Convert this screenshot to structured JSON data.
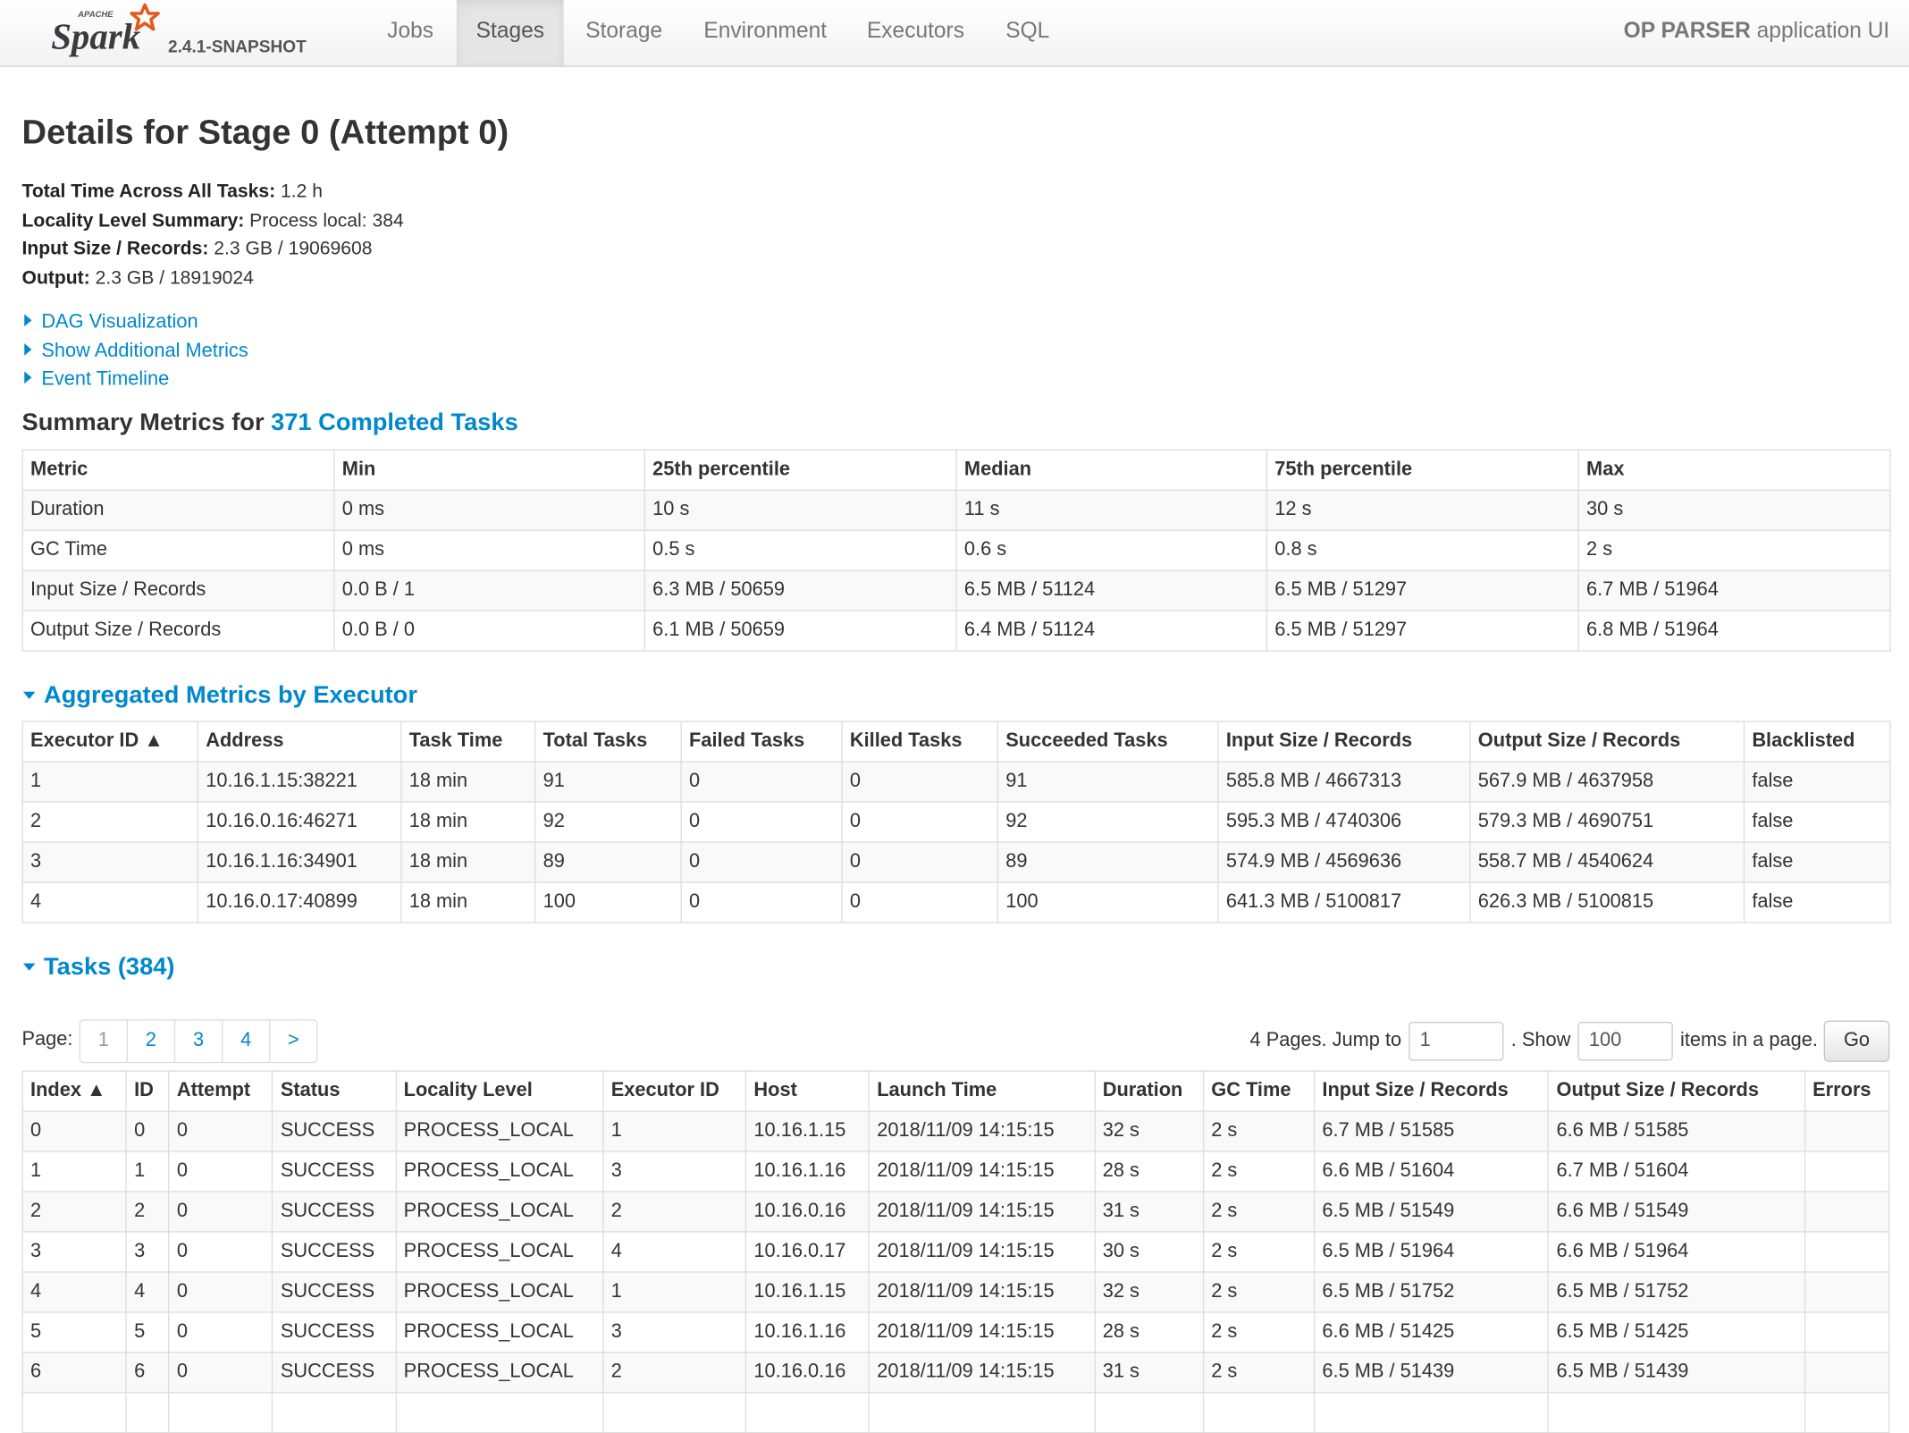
{
  "navbar": {
    "brand_small": "APACHE",
    "brand": "Spark",
    "version": "2.4.1-SNAPSHOT",
    "tabs": [
      "Jobs",
      "Stages",
      "Storage",
      "Environment",
      "Executors",
      "SQL"
    ],
    "active_tab": "Stages",
    "app_name_bold": "OP PARSER",
    "app_name_rest": " application UI"
  },
  "page": {
    "title": "Details for Stage 0 (Attempt 0)",
    "summary": [
      {
        "label": "Total Time Across All Tasks:",
        "value": " 1.2 h"
      },
      {
        "label": "Locality Level Summary:",
        "value": " Process local: 384"
      },
      {
        "label": "Input Size / Records:",
        "value": " 2.3 GB / 19069608"
      },
      {
        "label": "Output:",
        "value": " 2.3 GB / 18919024"
      }
    ],
    "expanders": [
      "DAG Visualization",
      "Show Additional Metrics",
      "Event Timeline"
    ]
  },
  "summary_metrics": {
    "heading_prefix": "Summary Metrics for ",
    "heading_link": "371 Completed Tasks",
    "columns": [
      "Metric",
      "Min",
      "25th percentile",
      "Median",
      "75th percentile",
      "Max"
    ],
    "rows": [
      [
        "Duration",
        "0 ms",
        "10 s",
        "11 s",
        "12 s",
        "30 s"
      ],
      [
        "GC Time",
        "0 ms",
        "0.5 s",
        "0.6 s",
        "0.8 s",
        "2 s"
      ],
      [
        "Input Size / Records",
        "0.0 B / 1",
        "6.3 MB / 50659",
        "6.5 MB / 51124",
        "6.5 MB / 51297",
        "6.7 MB / 51964"
      ],
      [
        "Output Size / Records",
        "0.0 B / 0",
        "6.1 MB / 50659",
        "6.4 MB / 51124",
        "6.5 MB / 51297",
        "6.8 MB / 51964"
      ]
    ]
  },
  "executor_metrics": {
    "heading": "Aggregated Metrics by Executor",
    "columns": [
      "Executor ID ▲",
      "Address",
      "Task Time",
      "Total Tasks",
      "Failed Tasks",
      "Killed Tasks",
      "Succeeded Tasks",
      "Input Size / Records",
      "Output Size / Records",
      "Blacklisted"
    ],
    "rows": [
      [
        "1",
        "10.16.1.15:38221",
        "18 min",
        "91",
        "0",
        "0",
        "91",
        "585.8 MB / 4667313",
        "567.9 MB / 4637958",
        "false"
      ],
      [
        "2",
        "10.16.0.16:46271",
        "18 min",
        "92",
        "0",
        "0",
        "92",
        "595.3 MB / 4740306",
        "579.3 MB / 4690751",
        "false"
      ],
      [
        "3",
        "10.16.1.16:34901",
        "18 min",
        "89",
        "0",
        "0",
        "89",
        "574.9 MB / 4569636",
        "558.7 MB / 4540624",
        "false"
      ],
      [
        "4",
        "10.16.0.17:40899",
        "18 min",
        "100",
        "0",
        "0",
        "100",
        "641.3 MB / 5100817",
        "626.3 MB / 5100815",
        "false"
      ]
    ]
  },
  "tasks": {
    "heading": "Tasks (384)",
    "pager": {
      "label": "Page:",
      "pages": [
        "1",
        "2",
        "3",
        "4",
        ">"
      ],
      "pages_text": "4 Pages. Jump to",
      "jump_value": "1",
      "show_text": ". Show",
      "show_value": "100",
      "items_text": "items in a page.",
      "go_label": "Go"
    },
    "columns": [
      "Index ▲",
      "ID",
      "Attempt",
      "Status",
      "Locality Level",
      "Executor ID",
      "Host",
      "Launch Time",
      "Duration",
      "GC Time",
      "Input Size / Records",
      "Output Size / Records",
      "Errors"
    ],
    "rows": [
      [
        "0",
        "0",
        "0",
        "SUCCESS",
        "PROCESS_LOCAL",
        "1",
        "10.16.1.15",
        "2018/11/09 14:15:15",
        "32 s",
        "2 s",
        "6.7 MB / 51585",
        "6.6 MB / 51585",
        ""
      ],
      [
        "1",
        "1",
        "0",
        "SUCCESS",
        "PROCESS_LOCAL",
        "3",
        "10.16.1.16",
        "2018/11/09 14:15:15",
        "28 s",
        "2 s",
        "6.6 MB / 51604",
        "6.7 MB / 51604",
        ""
      ],
      [
        "2",
        "2",
        "0",
        "SUCCESS",
        "PROCESS_LOCAL",
        "2",
        "10.16.0.16",
        "2018/11/09 14:15:15",
        "31 s",
        "2 s",
        "6.5 MB / 51549",
        "6.6 MB / 51549",
        ""
      ],
      [
        "3",
        "3",
        "0",
        "SUCCESS",
        "PROCESS_LOCAL",
        "4",
        "10.16.0.17",
        "2018/11/09 14:15:15",
        "30 s",
        "2 s",
        "6.5 MB / 51964",
        "6.6 MB / 51964",
        ""
      ],
      [
        "4",
        "4",
        "0",
        "SUCCESS",
        "PROCESS_LOCAL",
        "1",
        "10.16.1.15",
        "2018/11/09 14:15:15",
        "32 s",
        "2 s",
        "6.5 MB / 51752",
        "6.5 MB / 51752",
        ""
      ],
      [
        "5",
        "5",
        "0",
        "SUCCESS",
        "PROCESS_LOCAL",
        "3",
        "10.16.1.16",
        "2018/11/09 14:15:15",
        "28 s",
        "2 s",
        "6.6 MB / 51425",
        "6.5 MB / 51425",
        ""
      ],
      [
        "6",
        "6",
        "0",
        "SUCCESS",
        "PROCESS_LOCAL",
        "2",
        "10.16.0.16",
        "2018/11/09 14:15:15",
        "31 s",
        "2 s",
        "6.5 MB / 51439",
        "6.5 MB / 51439",
        ""
      ],
      [
        "",
        "",
        "",
        "",
        "",
        "",
        "",
        "",
        "",
        "",
        "",
        "",
        ""
      ]
    ]
  }
}
